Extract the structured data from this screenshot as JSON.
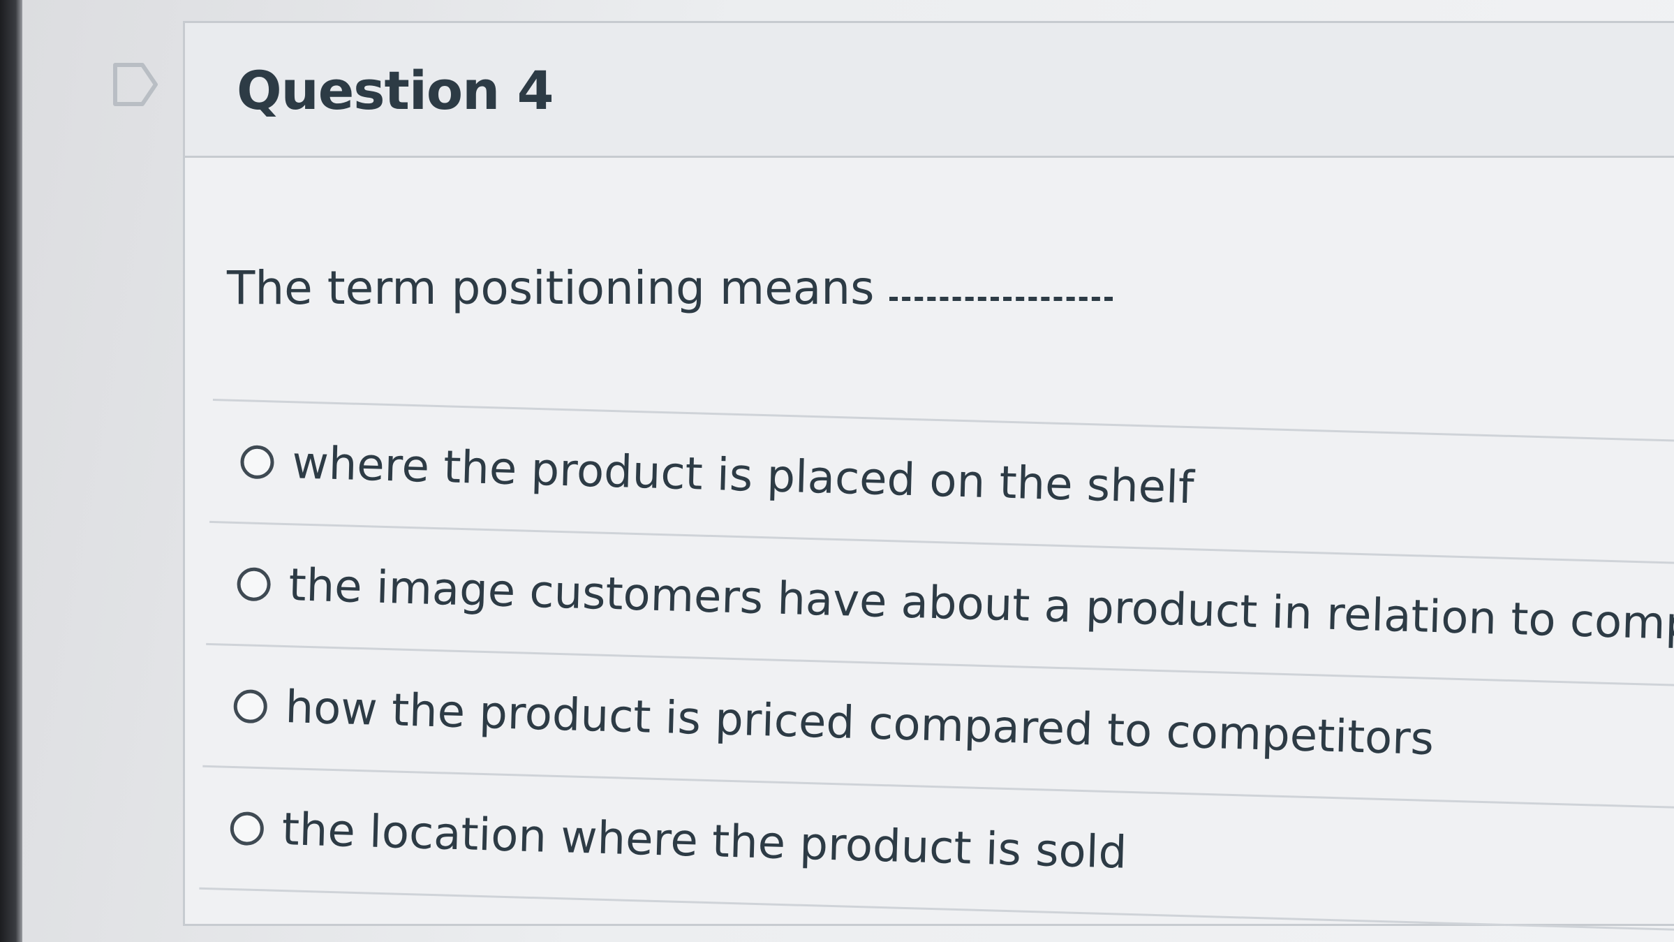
{
  "question": {
    "title": "Question 4",
    "prompt": "The term positioning means"
  },
  "answers": [
    {
      "label": "where the product is placed on the shelf",
      "selected": false
    },
    {
      "label": "the image customers have about a product in relation to competitors",
      "selected": false
    },
    {
      "label": "how the product is priced compared to competitors",
      "selected": false
    },
    {
      "label": "the location where the product is sold",
      "selected": false
    }
  ],
  "icons": {
    "flag": "flag-icon",
    "radio": "radio-button-icon"
  },
  "colors": {
    "text": "#2d3b45",
    "border": "#c7cbd0",
    "background": "#f0f1f3"
  }
}
